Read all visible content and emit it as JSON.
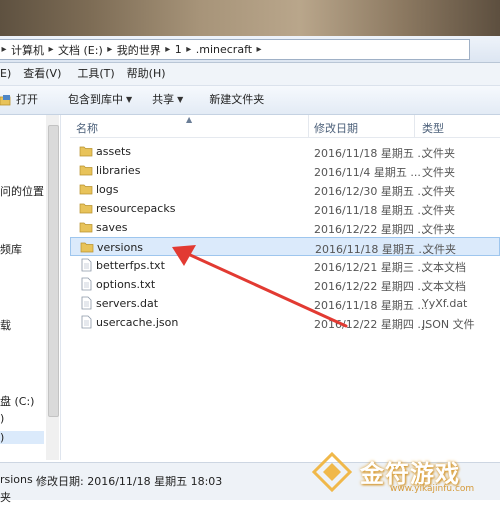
{
  "address": {
    "crumbs": [
      "计算机",
      "文档 (E:)",
      "我的世界",
      "1",
      ".minecraft"
    ]
  },
  "menu": [
    "E)",
    "查看(V)",
    "工具(T)",
    "帮助(H)"
  ],
  "toolbar": {
    "open": "打开",
    "include_library": "包含到库中",
    "share": "共享",
    "new_folder": "新建文件夹"
  },
  "nav": {
    "item1": "问的位置",
    "item2": "频库",
    "item3": "载",
    "drive_c": "盘 (C:)",
    "drive_d": ")",
    "drive_e": ")"
  },
  "columns": {
    "name": "名称",
    "date": "修改日期",
    "type": "类型"
  },
  "files": [
    {
      "name": "assets",
      "date": "2016/11/18 星期五 ...",
      "type": "文件夹",
      "kind": "folder"
    },
    {
      "name": "libraries",
      "date": "2016/11/4 星期五 ...",
      "type": "文件夹",
      "kind": "folder"
    },
    {
      "name": "logs",
      "date": "2016/12/30 星期五 ...",
      "type": "文件夹",
      "kind": "folder"
    },
    {
      "name": "resourcepacks",
      "date": "2016/11/18 星期五 ...",
      "type": "文件夹",
      "kind": "folder"
    },
    {
      "name": "saves",
      "date": "2016/12/22 星期四 ...",
      "type": "文件夹",
      "kind": "folder"
    },
    {
      "name": "versions",
      "date": "2016/11/18 星期五 ...",
      "type": "文件夹",
      "kind": "folder"
    },
    {
      "name": "betterfps.txt",
      "date": "2016/12/21 星期三 ...",
      "type": "文本文档",
      "kind": "file"
    },
    {
      "name": "options.txt",
      "date": "2016/12/22 星期四 ...",
      "type": "文本文档",
      "kind": "file"
    },
    {
      "name": "servers.dat",
      "date": "2016/11/18 星期五 ...",
      "type": "YyXf.dat",
      "kind": "file"
    },
    {
      "name": "usercache.json",
      "date": "2016/12/22 星期四 ...",
      "type": "JSON 文件",
      "kind": "file"
    }
  ],
  "status": {
    "name": "rsions",
    "modified_label": "修改日期: 2016/11/18 星期五 18:03",
    "row2": "夹"
  },
  "watermark": {
    "brand": "金符游戏",
    "url": "www.yikajinfu.com"
  },
  "colors": {
    "selection": "#dbeafb",
    "arrow": "#e23a32",
    "folder": "#e8c35a"
  }
}
